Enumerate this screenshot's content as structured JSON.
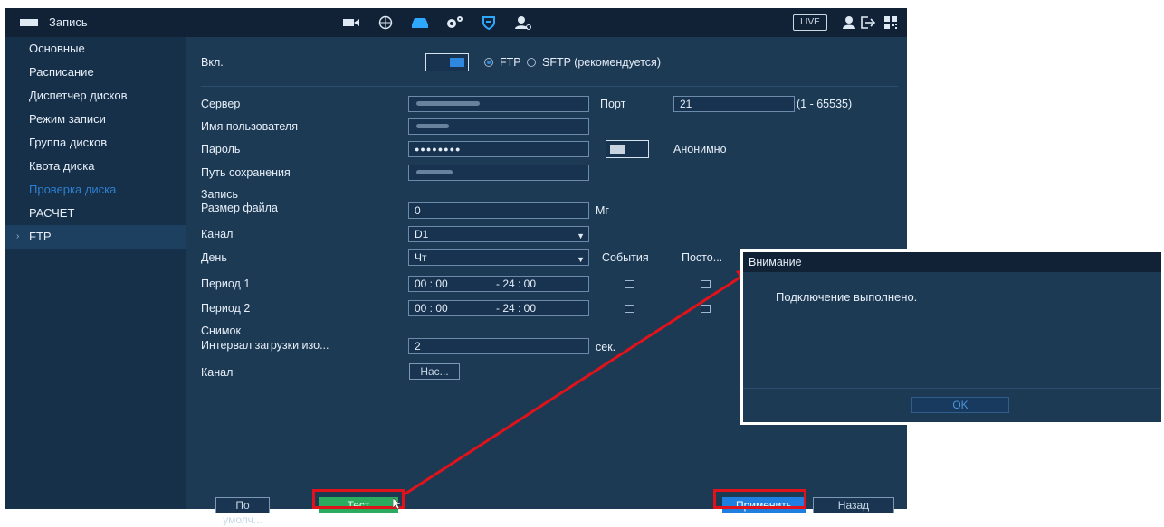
{
  "topbar": {
    "title": "Запись",
    "live_label": "LIVE",
    "icons": [
      "camera-icon",
      "network-icon",
      "storage-icon",
      "settings-icon",
      "shield-icon",
      "account-icon",
      "user-icon",
      "logout-icon",
      "qr-icon"
    ]
  },
  "sidebar": {
    "items": [
      {
        "label": "Основные"
      },
      {
        "label": "Расписание"
      },
      {
        "label": "Диспетчер дисков"
      },
      {
        "label": "Режим записи"
      },
      {
        "label": "Группа дисков"
      },
      {
        "label": "Квота диска"
      },
      {
        "label": "Проверка диска"
      },
      {
        "label": "РАСЧЕТ"
      },
      {
        "label": "FTP"
      }
    ]
  },
  "form": {
    "enable_label": "Вкл.",
    "ftp_label": "FTP",
    "sftp_label": "SFTP (рекомендуется)",
    "server_label": "Сервер",
    "port_label": "Порт",
    "port_value": "21",
    "port_range": "(1 - 65535)",
    "username_label": "Имя пользователя",
    "password_label": "Пароль",
    "password_value": "●●●●●●●●",
    "anonymous_label": "Анонимно",
    "save_path_label": "Путь сохранения",
    "record_section": "Запись",
    "file_size_label": "Размер файла",
    "file_size_value": "0",
    "file_size_unit": "Мг",
    "channel_label": "Канал",
    "channel_value": "D1",
    "day_label": "День",
    "day_value": "Чт",
    "events_label": "События",
    "constant_label": "Посто...",
    "period1_label": "Период 1",
    "period1_start": "00 : 00",
    "period1_end": "- 24 : 00",
    "period2_label": "Период 2",
    "period2_start": "00 : 00",
    "period2_end": "- 24 : 00",
    "snapshot_section": "Снимок",
    "upload_interval_label": "Интервал загрузки изо...",
    "upload_interval_value": "2",
    "upload_interval_unit": "сек.",
    "snap_channel_label": "Канал",
    "snap_channel_button": "Нас..."
  },
  "buttons": {
    "default": "По умолч...",
    "test": "Тест",
    "apply": "Применить",
    "back": "Назад"
  },
  "dialog": {
    "title": "Внимание",
    "message": "Подключение выполнено.",
    "ok": "OK"
  },
  "colors": {
    "annotation": "#e2121b",
    "accent": "#1e7fe0",
    "test_button": "#2bab5d"
  }
}
